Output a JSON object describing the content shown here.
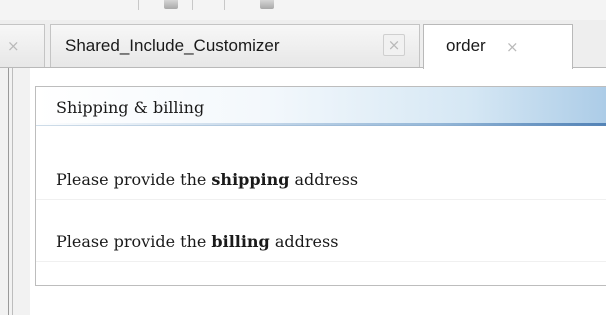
{
  "tabs": [
    {
      "label": "",
      "close_glyph": "×",
      "active": false
    },
    {
      "label": "Shared_Include_Customizer",
      "close_glyph": "×",
      "active": false
    },
    {
      "label": "order",
      "close_glyph": "×",
      "active": true
    }
  ],
  "form": {
    "header": "Shipping & billing",
    "rows": [
      {
        "prefix": "Please provide the ",
        "emphasis": "shipping",
        "suffix": " address"
      },
      {
        "prefix": "Please provide the ",
        "emphasis": "billing",
        "suffix": " address"
      }
    ]
  },
  "colors": {
    "header_gradient_end": "#a9cae6",
    "tab_border": "#c4c4c4",
    "close_icon": "#b9b9b9"
  }
}
